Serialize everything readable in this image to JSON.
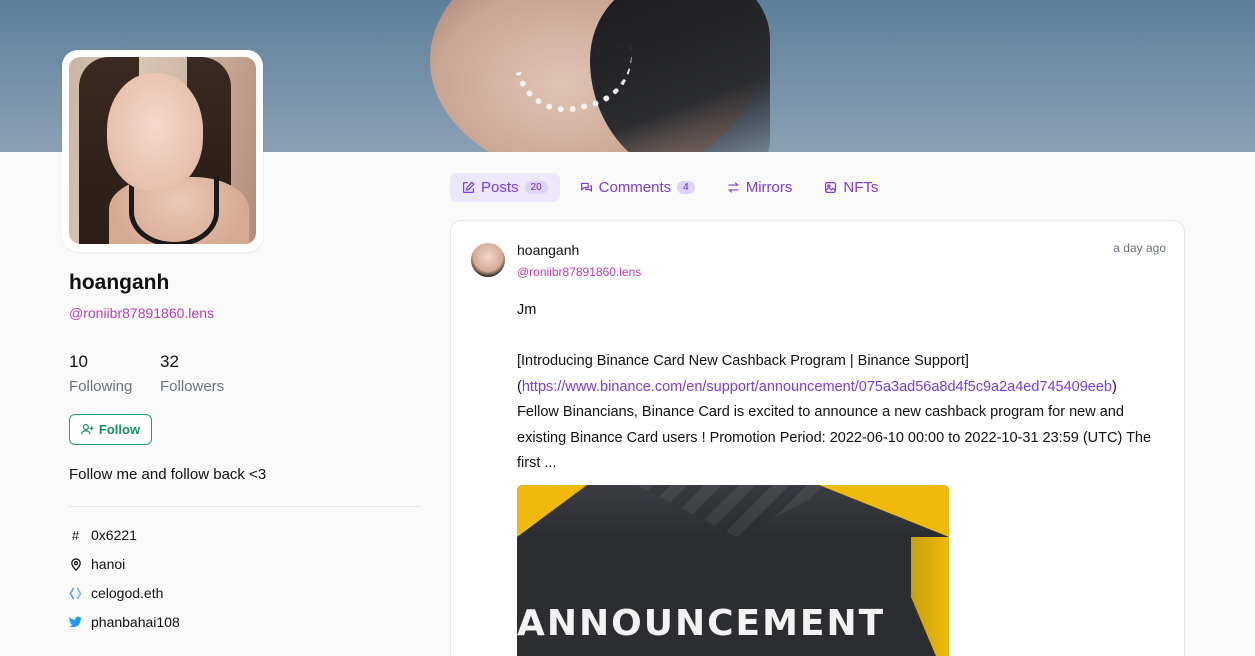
{
  "profile": {
    "name": "hoanganh",
    "handle": "@roniibr87891860.lens",
    "following_count": "10",
    "following_label": "Following",
    "followers_count": "32",
    "followers_label": "Followers",
    "follow_label": "Follow",
    "bio": "Follow me and follow back <3",
    "meta": {
      "id": "0x6221",
      "location": "hanoi",
      "ens": "celogod.eth",
      "twitter": "phanbahai108"
    }
  },
  "tabs": [
    {
      "label": "Posts",
      "count": "20",
      "icon": "pencil-square-icon"
    },
    {
      "label": "Comments",
      "count": "4",
      "icon": "chat-bubbles-icon"
    },
    {
      "label": "Mirrors",
      "icon": "switch-arrows-icon"
    },
    {
      "label": "NFTs",
      "icon": "photo-icon"
    }
  ],
  "post": {
    "author_name": "hoanganh",
    "author_handle": "@roniibr87891860.lens",
    "time": "a day ago",
    "line1": "Jm",
    "line2": "[Introducing Binance Card New Cashback Program | Binance Support]",
    "link_open": "(",
    "link": "https://www.binance.com/en/support/announcement/075a3ad56a8d4f5c9a2a4ed745409eeb",
    "link_close": ")",
    "line3": "Fellow Binancians, Binance Card  is excited to announce  a new cashback program  for  new and existing Binance Card users ! Promotion Period:  2022-06-10 00:00 to 2022-10-31 23:59 (UTC) The first ...",
    "image_text": "ANNOUNCEMENT"
  },
  "colors": {
    "accent": "#7c3aed",
    "handle": "#c13bb1",
    "follow": "#16905c",
    "binance_yellow": "#f0b90b"
  }
}
